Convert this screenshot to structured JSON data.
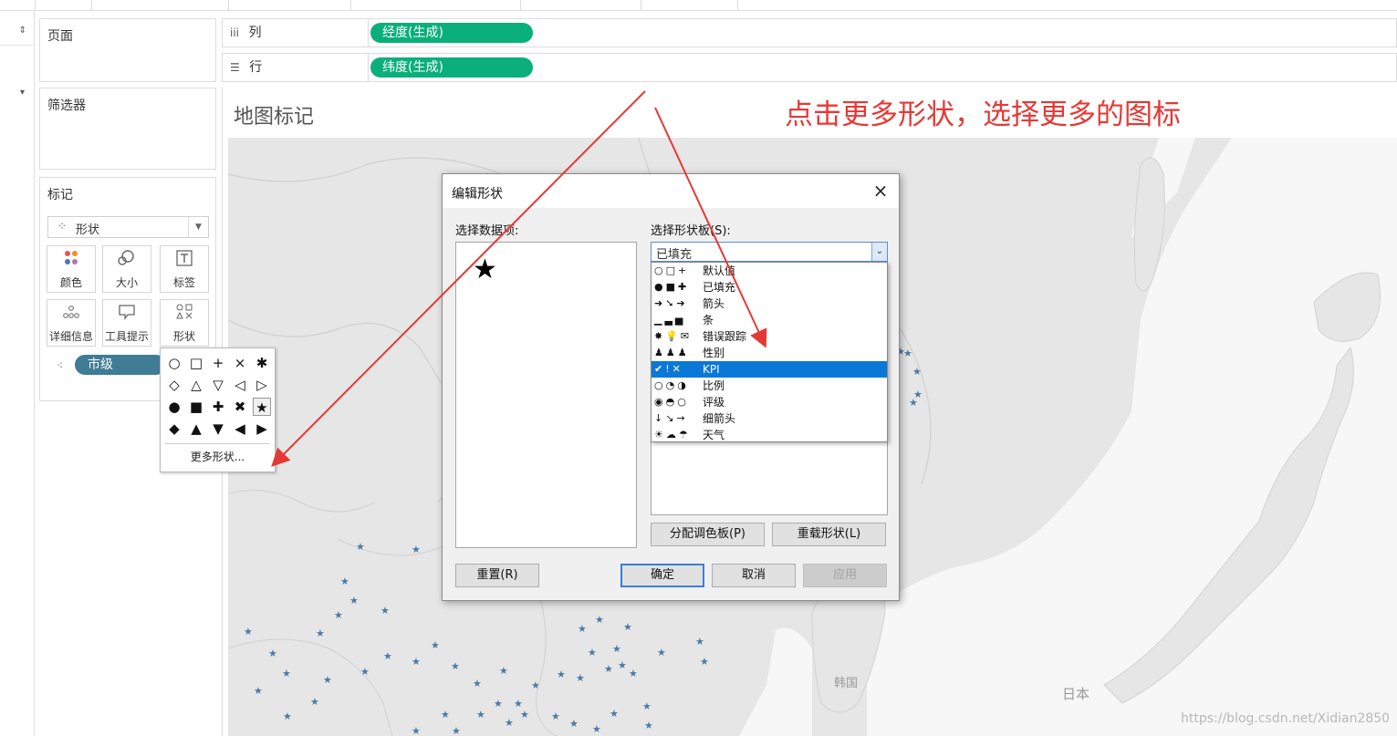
{
  "shelves": {
    "pages_title": "页面",
    "filters_title": "筛选器",
    "columns": {
      "icon": "iii",
      "label": "列",
      "pill": "经度(生成)"
    },
    "rows": {
      "icon": "☰",
      "label": "行",
      "pill": "纬度(生成)"
    }
  },
  "marks": {
    "title": "标记",
    "mark_type": "形状",
    "buttons": [
      {
        "label": "颜色",
        "icon": "color-dots-icon"
      },
      {
        "label": "大小",
        "icon": "size-icon"
      },
      {
        "label": "标签",
        "icon": "label-T-icon"
      },
      {
        "label": "详细信息",
        "icon": "detail-dots-icon"
      },
      {
        "label": "工具提示",
        "icon": "tooltip-icon"
      },
      {
        "label": "形状",
        "icon": "shape-icon"
      }
    ],
    "field_pill": "市级"
  },
  "view": {
    "title": "地图标记"
  },
  "annotation": "点击更多形状，选择更多的图标",
  "shape_palette": {
    "rows": [
      [
        "○",
        "□",
        "+",
        "×",
        "✱"
      ],
      [
        "◇",
        "△",
        "▽",
        "◁",
        "▷"
      ],
      [
        "●",
        "■",
        "✚",
        "✖",
        "★"
      ],
      [
        "◆",
        "▲",
        "▼",
        "◀",
        "▶"
      ]
    ],
    "selected": "★",
    "more_label": "更多形状..."
  },
  "dialog": {
    "title": "编辑形状",
    "close": "×",
    "select_item_label": "选择数据项:",
    "select_palette_label": "选择形状板(S):",
    "palette_value": "已填充",
    "item_shape": "★",
    "palettes": [
      {
        "icons": "○□+",
        "name": "默认值"
      },
      {
        "icons": "●■✚",
        "name": "已填充"
      },
      {
        "icons": "➜➘➔",
        "name": "箭头"
      },
      {
        "icons": "▁▃▅",
        "name": "条"
      },
      {
        "icons": "✸💡✉",
        "name": "错误跟踪"
      },
      {
        "icons": "♟♟♟",
        "name": "性别"
      },
      {
        "icons": "✔!✕",
        "name": "KPI"
      },
      {
        "icons": "○◔◑",
        "name": "比例"
      },
      {
        "icons": "◉◓○",
        "name": "评级"
      },
      {
        "icons": "↓↘→",
        "name": "细箭头"
      },
      {
        "icons": "☀☁☂",
        "name": "天气"
      }
    ],
    "selected_palette": "KPI",
    "assign_palette_btn": "分配调色板(P)",
    "reload_shapes_btn": "重载形状(L)",
    "reset_btn": "重置(R)",
    "ok_btn": "确定",
    "cancel_btn": "取消",
    "apply_btn": "应用"
  },
  "map_labels": {
    "korea": "韩国",
    "japan": "日本"
  },
  "watermark": "https://blog.csdn.net/Xidian2850",
  "colors": {
    "annotation": "#e53935",
    "green_pill": "#0baf7a",
    "blue_pill": "#3f7c96",
    "star_marks": "#4a7aa6",
    "selection": "#0a78d7"
  }
}
